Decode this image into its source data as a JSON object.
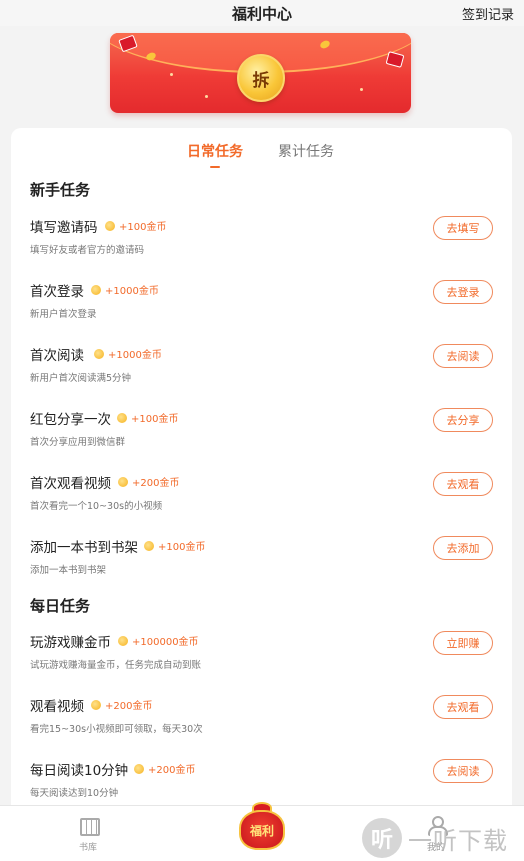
{
  "header": {
    "title": "福利中心",
    "record_label": "签到记录"
  },
  "banner": {
    "coin_text": "拆",
    "colors": {
      "red": "#ef3b36",
      "gold": "#f9c638"
    }
  },
  "tabs": [
    {
      "label": "日常任务",
      "active": true
    },
    {
      "label": "累计任务",
      "active": false
    }
  ],
  "sections": [
    {
      "title": "新手任务",
      "tasks": [
        {
          "name": "填写邀请码",
          "reward": "+100金币",
          "desc": "填写好友或者官方的邀请码",
          "button": "去填写"
        },
        {
          "name": "首次登录",
          "reward": "+1000金币",
          "desc": "新用户首次登录",
          "button": "去登录"
        },
        {
          "name": "首次阅读",
          "reward": "+1000金币",
          "desc": "新用户首次阅读满5分钟",
          "button": "去阅读"
        },
        {
          "name": "红包分享一次",
          "reward": "+100金币",
          "desc": "首次分享应用到微信群",
          "button": "去分享"
        },
        {
          "name": "首次观看视频",
          "reward": "+200金币",
          "desc": "首次看完一个10~30s的小视频",
          "button": "去观看"
        },
        {
          "name": "添加一本书到书架",
          "reward": "+100金币",
          "desc": "添加一本书到书架",
          "button": "去添加"
        }
      ]
    },
    {
      "title": "每日任务",
      "tasks": [
        {
          "name": "玩游戏赚金币",
          "reward": "+100000金币",
          "desc": "试玩游戏赚海量金币，任务完成自动到账",
          "button": "立即赚"
        },
        {
          "name": "观看视频",
          "reward": "+200金币",
          "desc": "看完15~30s小视频即可领取，每天30次",
          "button": "去观看"
        },
        {
          "name": "每日阅读10分钟",
          "reward": "+200金币",
          "desc": "每天阅读达到10分钟",
          "button": "去阅读"
        }
      ]
    }
  ],
  "bottom_nav": {
    "books_label": "书库",
    "center_label": "福利",
    "me_label": "我的",
    "icons": {
      "books": "bookshelf-icon",
      "center": "lucky-bag-icon",
      "me": "person-icon"
    }
  },
  "watermark": {
    "logo": "听",
    "text": "一听下载"
  },
  "colors": {
    "accent": "#f26a2a",
    "button_border": "#f08a5d"
  }
}
